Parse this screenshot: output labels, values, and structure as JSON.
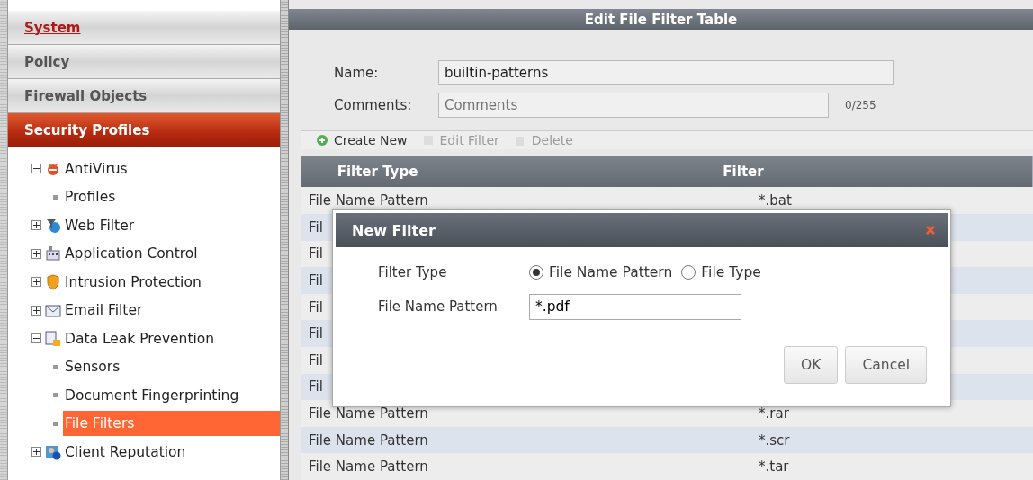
{
  "sidebar": {
    "sections": [
      {
        "label": "System",
        "selected": false,
        "link": true
      },
      {
        "label": "Policy",
        "selected": false,
        "link": false
      },
      {
        "label": "Firewall Objects",
        "selected": false,
        "link": false
      },
      {
        "label": "Security Profiles",
        "selected": true,
        "link": false
      }
    ],
    "tree": [
      {
        "label": "AntiVirus",
        "expanded": true,
        "children": [
          {
            "label": "Profiles",
            "selected": false
          }
        ]
      },
      {
        "label": "Web Filter",
        "expanded": false
      },
      {
        "label": "Application Control",
        "expanded": false
      },
      {
        "label": "Intrusion Protection",
        "expanded": false
      },
      {
        "label": "Email Filter",
        "expanded": false
      },
      {
        "label": "Data Leak Prevention",
        "expanded": true,
        "children": [
          {
            "label": "Sensors",
            "selected": false
          },
          {
            "label": "Document Fingerprinting",
            "selected": false
          },
          {
            "label": "File Filters",
            "selected": true
          }
        ]
      },
      {
        "label": "Client Reputation",
        "expanded": false
      }
    ]
  },
  "panel": {
    "title": "Edit File Filter Table",
    "name_label": "Name:",
    "name_value": "builtin-patterns",
    "comments_label": "Comments:",
    "comments_placeholder": "Comments",
    "comments_count": "0/255",
    "toolbar": [
      {
        "label": "Create New",
        "disabled": false
      },
      {
        "label": "Edit Filter",
        "disabled": true
      },
      {
        "label": "Delete",
        "disabled": true
      }
    ],
    "table": {
      "columns": [
        "Filter Type",
        "Filter"
      ],
      "rows": [
        {
          "filter_type": "File Name Pattern",
          "filter": "*.bat"
        },
        {
          "filter_type": "Fil"
        },
        {
          "filter_type": "Fil"
        },
        {
          "filter_type": "Fil"
        },
        {
          "filter_type": "Fil"
        },
        {
          "filter_type": "Fil"
        },
        {
          "filter_type": "Fil"
        },
        {
          "filter_type": "Fil"
        },
        {
          "filter_type": "File Name Pattern",
          "filter": "*.rar"
        },
        {
          "filter_type": "File Name Pattern",
          "filter": "*.scr"
        },
        {
          "filter_type": "File Name Pattern",
          "filter": "*.tar"
        }
      ]
    }
  },
  "dialog": {
    "title": "New Filter",
    "filter_type_label": "Filter Type",
    "options": [
      {
        "label": "File Name Pattern",
        "selected": true
      },
      {
        "label": "File Type",
        "selected": false
      }
    ],
    "pattern_label": "File Name Pattern",
    "pattern_value": "*.pdf",
    "buttons": [
      "OK",
      "Cancel"
    ]
  }
}
